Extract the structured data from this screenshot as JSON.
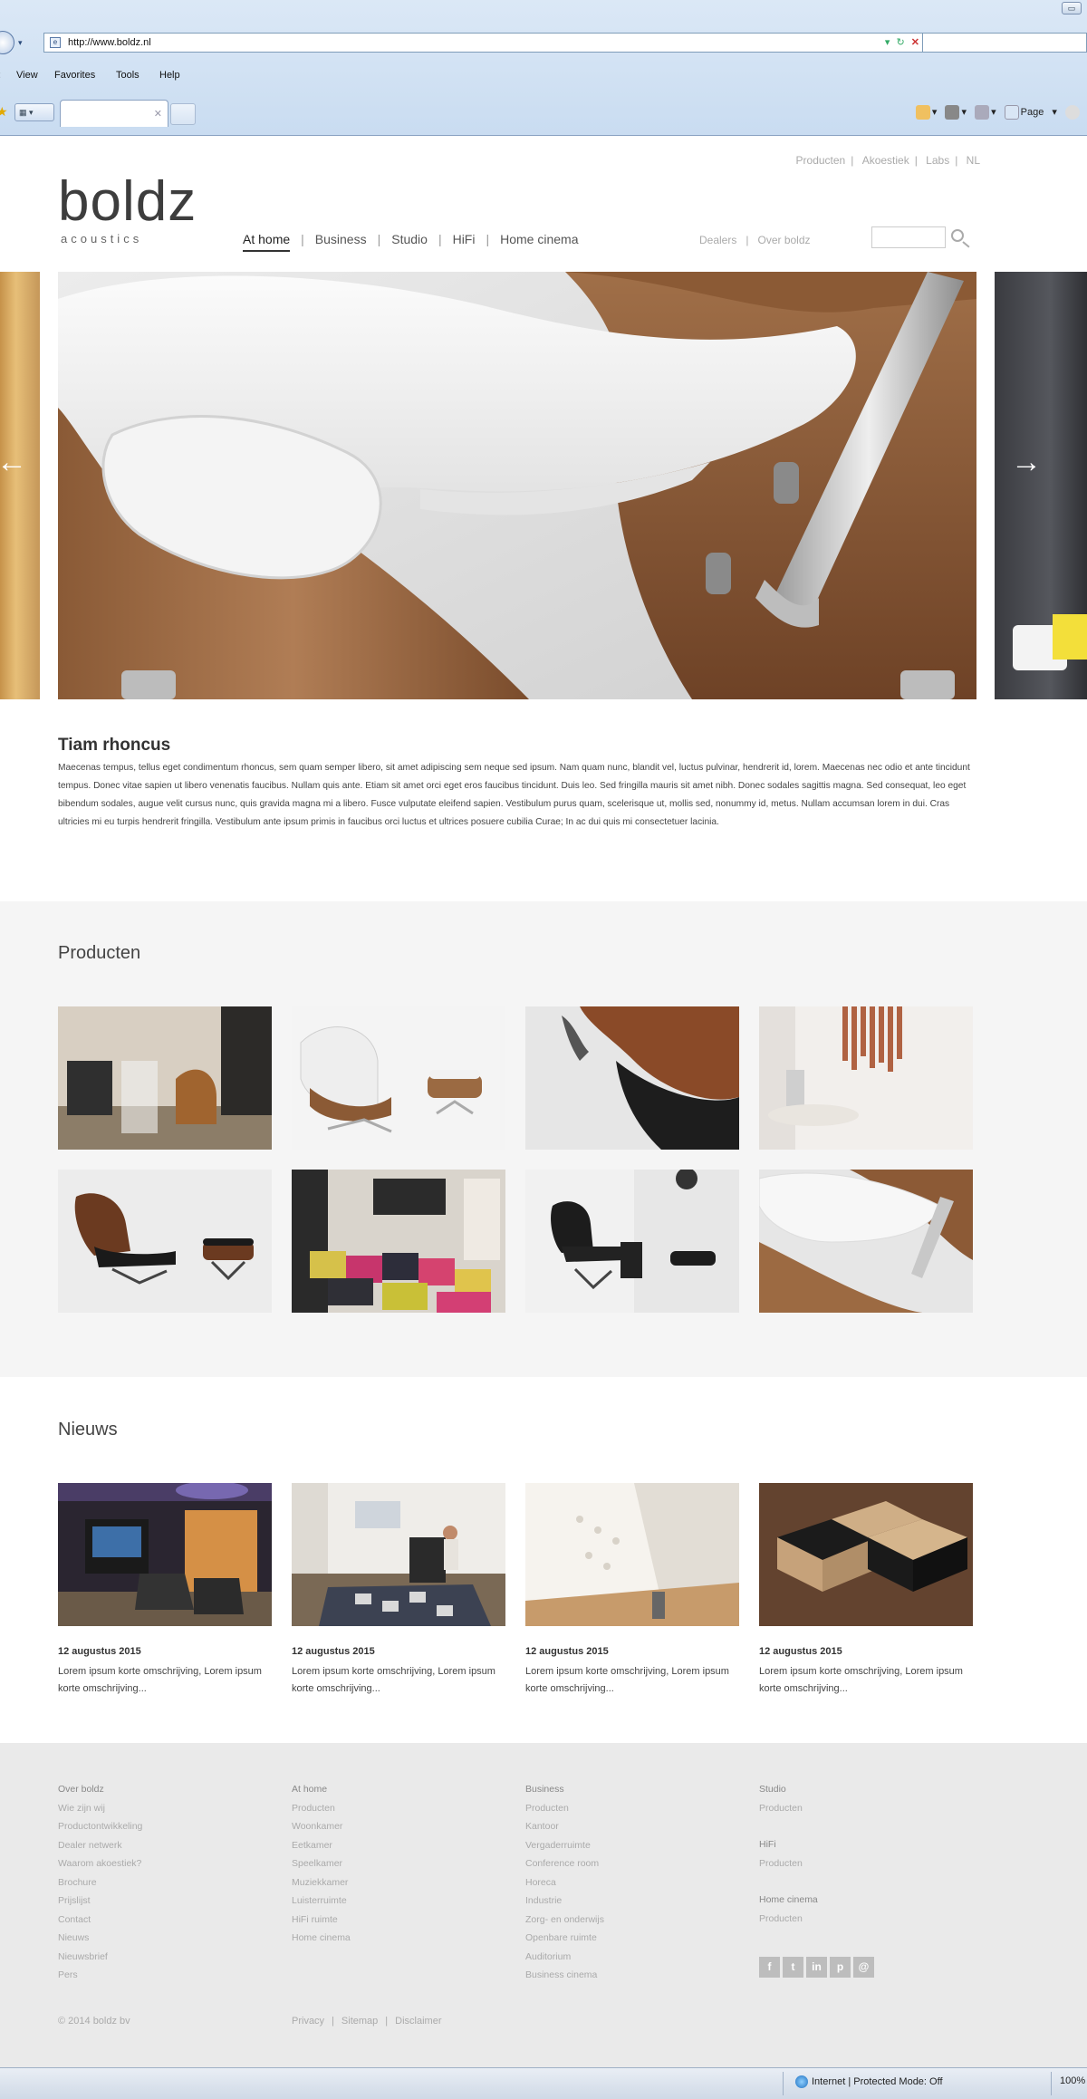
{
  "browser": {
    "address": "http://www.boldz.nl",
    "menu": [
      "View",
      "Favorites",
      "Tools",
      "Help"
    ],
    "toolbar_icons": [
      "home-icon",
      "rss-icon",
      "print-icon",
      "page-icon"
    ],
    "page_label": "Page"
  },
  "site": {
    "logo_word": "boldz",
    "logo_sub": "acoustics",
    "top_nav": [
      "Producten",
      "Akoestiek",
      "Labs",
      "NL"
    ],
    "main_nav": [
      "At home",
      "Business",
      "Studio",
      "HiFi",
      "Home cinema"
    ],
    "main_nav_active": "At home",
    "sub_nav": [
      "Dealers",
      "Over boldz"
    ],
    "search_placeholder": ""
  },
  "intro": {
    "title": "Tiam rhoncus",
    "body": "Maecenas tempus, tellus eget condimentum rhoncus, sem quam semper libero, sit amet adipiscing sem neque sed ipsum. Nam quam nunc, blandit vel, luctus pulvinar, hendrerit id, lorem. Maecenas nec odio et ante tincidunt tempus. Donec vitae sapien ut libero venenatis faucibus. Nullam quis ante. Etiam sit amet orci eget eros faucibus tincidunt. Duis leo. Sed fringilla mauris sit amet nibh. Donec sodales sagittis magna. Sed consequat, leo eget bibendum sodales, augue velit cursus nunc, quis gravida magna mi a libero. Fusce vulputate eleifend sapien. Vestibulum purus quam, scelerisque ut, mollis sed, nonummy id, metus. Nullam accumsan lorem in dui. Cras ultricies mi eu turpis hendrerit fringilla. Vestibulum ante ipsum primis in faucibus orci luctus et ultrices posuere cubilia Curae; In ac dui quis mi consectetuer lacinia."
  },
  "products": {
    "title": "Producten"
  },
  "news": {
    "title": "Nieuws",
    "items": [
      {
        "date": "12 augustus 2015",
        "text": "Lorem ipsum korte omschrijving, Lorem ipsum korte omschrijving..."
      },
      {
        "date": "12 augustus 2015",
        "text": "Lorem ipsum korte omschrijving, Lorem ipsum korte omschrijving..."
      },
      {
        "date": "12 augustus 2015",
        "text": "Lorem ipsum korte omschrijving, Lorem ipsum korte omschrijving..."
      },
      {
        "date": "12 augustus 2015",
        "text": "Lorem ipsum korte omschrijving, Lorem ipsum korte omschrijving..."
      }
    ]
  },
  "footer": {
    "col1": {
      "head": "Over boldz",
      "items": [
        "Wie zijn wij",
        "Productontwikkeling",
        "Dealer netwerk",
        "Waarom akoestiek?",
        "Brochure",
        "Prijslijst",
        "Contact",
        "Nieuws",
        "Nieuwsbrief",
        "Pers"
      ]
    },
    "col2": {
      "head": "At home",
      "items": [
        "Producten",
        "Woonkamer",
        "Eetkamer",
        "Speelkamer",
        "Muziekkamer",
        "Luisterruimte",
        "HiFi ruimte",
        "Home cinema"
      ]
    },
    "col3": {
      "head": "Business",
      "items": [
        "Producten",
        "Kantoor",
        "Vergaderruimte",
        "Conference room",
        "Horeca",
        "Industrie",
        "Zorg- en onderwijs",
        "Openbare ruimte",
        "Auditorium",
        "Business cinema"
      ]
    },
    "col4": {
      "head": "Studio",
      "items": [
        "Producten"
      ],
      "head2": "HiFi",
      "items2": [
        "Producten"
      ],
      "head3": "Home cinema",
      "items3": [
        "Producten"
      ]
    },
    "social": [
      "f",
      "t",
      "in",
      "p",
      "@"
    ],
    "copyright": "© 2014 boldz bv",
    "legal": [
      "Privacy",
      "Sitemap",
      "Disclaimer"
    ]
  },
  "status": {
    "zone": "Internet | Protected Mode: Off",
    "zoom": "100%"
  }
}
